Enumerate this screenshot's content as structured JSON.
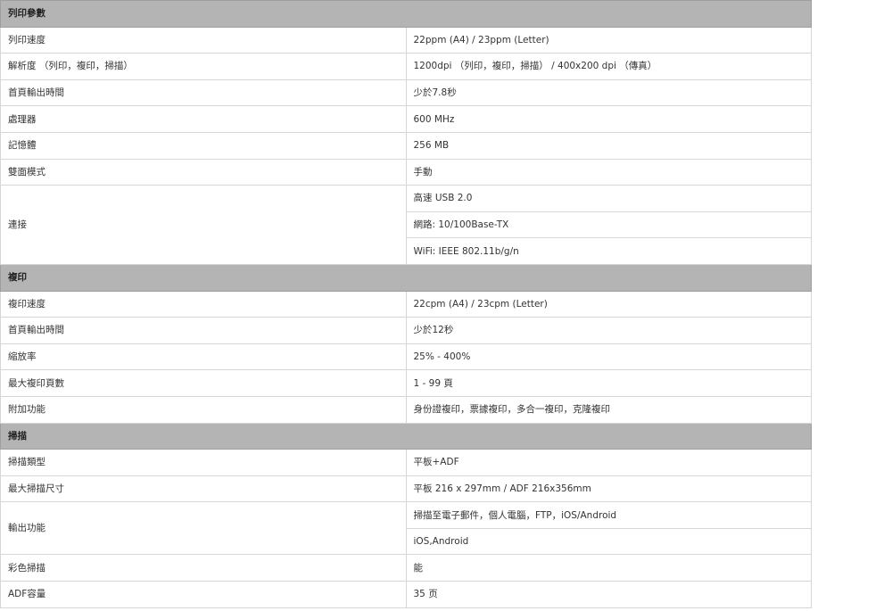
{
  "sections": [
    {
      "title": "列印參數",
      "rows": [
        {
          "label": "列印速度",
          "values": [
            "22ppm (A4) / 23ppm (Letter)"
          ]
        },
        {
          "label": "解析度 （列印，複印，掃描）",
          "values": [
            "1200dpi （列印，複印，掃描） / 400x200 dpi （傳真）"
          ]
        },
        {
          "label": "首頁輸出時間",
          "values": [
            "少於7.8秒"
          ]
        },
        {
          "label": "處理器",
          "values": [
            "600 MHz"
          ]
        },
        {
          "label": "記憶體",
          "values": [
            "256 MB"
          ]
        },
        {
          "label": "雙面模式",
          "values": [
            "手動"
          ]
        },
        {
          "label": "連接",
          "values": [
            "高速 USB 2.0",
            "網路: 10/100Base-TX",
            "WiFi: IEEE 802.11b/g/n"
          ]
        }
      ]
    },
    {
      "title": "複印",
      "rows": [
        {
          "label": "複印速度",
          "values": [
            "22cpm (A4) / 23cpm (Letter)"
          ]
        },
        {
          "label": "首頁輸出時間",
          "values": [
            "少於12秒"
          ]
        },
        {
          "label": "縮放率",
          "values": [
            "25% - 400%"
          ]
        },
        {
          "label": "最大複印頁數",
          "values": [
            "1 - 99 頁"
          ]
        },
        {
          "label": "附加功能",
          "values": [
            "身份證複印，票據複印，多合一複印，克隆複印"
          ]
        }
      ]
    },
    {
      "title": "掃描",
      "rows": [
        {
          "label": "掃描類型",
          "values": [
            "平板+ADF"
          ]
        },
        {
          "label": "最大掃描尺寸",
          "values": [
            "平板 216 x 297mm / ADF 216x356mm"
          ]
        },
        {
          "label": "輸出功能",
          "values": [
            "掃描至電子郵件，個人電腦，FTP，iOS/Android",
            "iOS,Android"
          ]
        },
        {
          "label": "彩色掃描",
          "values": [
            "能"
          ]
        },
        {
          "label": "ADF容量",
          "values": [
            "35 页"
          ]
        }
      ]
    }
  ]
}
